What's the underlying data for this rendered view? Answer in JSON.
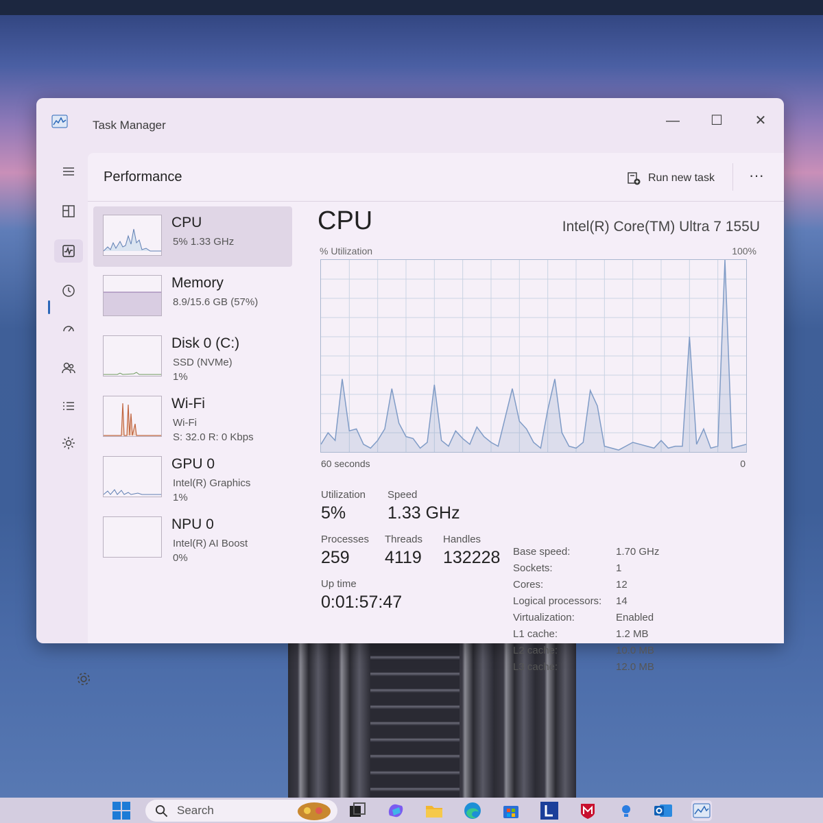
{
  "window": {
    "title": "Task Manager",
    "controls": {
      "minimize": "—",
      "maximize": "☐",
      "close": "✕"
    }
  },
  "header": {
    "title": "Performance",
    "run_new_task": "Run new task",
    "more": "···"
  },
  "nav": {
    "items": [
      "hamburger-icon",
      "processes-icon",
      "performance-icon",
      "app-history-icon",
      "startup-apps-icon",
      "users-icon",
      "details-icon",
      "services-icon"
    ],
    "active": "performance-icon"
  },
  "devices": [
    {
      "name": "CPU",
      "line1": "5%  1.33 GHz",
      "line2": ""
    },
    {
      "name": "Memory",
      "line1": "8.9/15.6 GB (57%)",
      "line2": ""
    },
    {
      "name": "Disk 0 (C:)",
      "line1": "SSD (NVMe)",
      "line2": "1%"
    },
    {
      "name": "Wi-Fi",
      "line1": "Wi-Fi",
      "line2": "S: 32.0  R: 0 Kbps"
    },
    {
      "name": "GPU 0",
      "line1": "Intel(R) Graphics",
      "line2": "1%"
    },
    {
      "name": "NPU 0",
      "line1": "Intel(R) AI Boost",
      "line2": "0%"
    }
  ],
  "cpu": {
    "title": "CPU",
    "model": "Intel(R) Core(TM) Ultra 7 155U",
    "y_label": "% Utilization",
    "y_max": "100%",
    "x_left": "60 seconds",
    "x_right": "0",
    "utilization_history": [
      4,
      10,
      6,
      38,
      11,
      12,
      4,
      2,
      6,
      12,
      33,
      15,
      8,
      7,
      2,
      5,
      35,
      6,
      3,
      11,
      7,
      4,
      13,
      8,
      5,
      3,
      18,
      33,
      16,
      12,
      5,
      2,
      22,
      38,
      10,
      3,
      2,
      5,
      32,
      24,
      3,
      2,
      1,
      3,
      5,
      4,
      3,
      2,
      6,
      2,
      3,
      3,
      2,
      4,
      12,
      2,
      3,
      3,
      2,
      3,
      4
    ],
    "history_spikes": [
      [
        52,
        60
      ],
      [
        57,
        100
      ]
    ],
    "stats": {
      "utilization_label": "Utilization",
      "utilization": "5%",
      "speed_label": "Speed",
      "speed": "1.33 GHz",
      "processes_label": "Processes",
      "processes": "259",
      "threads_label": "Threads",
      "threads": "4119",
      "handles_label": "Handles",
      "handles": "132228",
      "uptime_label": "Up time",
      "uptime": "0:01:57:47"
    },
    "properties": [
      {
        "k": "Base speed:",
        "v": "1.70 GHz"
      },
      {
        "k": "Sockets:",
        "v": "1"
      },
      {
        "k": "Cores:",
        "v": "12"
      },
      {
        "k": "Logical processors:",
        "v": "14"
      },
      {
        "k": "Virtualization:",
        "v": "Enabled"
      },
      {
        "k": "L1 cache:",
        "v": "1.2 MB"
      },
      {
        "k": "L2 cache:",
        "v": "10.0 MB"
      },
      {
        "k": "L3 cache:",
        "v": "12.0 MB"
      }
    ]
  },
  "taskbar": {
    "search_placeholder": "Search",
    "apps": [
      "windows-start-icon",
      "widgets-icon",
      "task-view-icon",
      "copilot-icon",
      "file-explorer-icon",
      "edge-icon",
      "store-icon",
      "l-app-icon",
      "mcafee-icon",
      "tips-icon",
      "outlook-icon",
      "task-manager-icon"
    ]
  },
  "colors": {
    "accent": "#2a67b8",
    "graph_line": "#7f9bc6",
    "wifi_line": "#c0653f"
  }
}
